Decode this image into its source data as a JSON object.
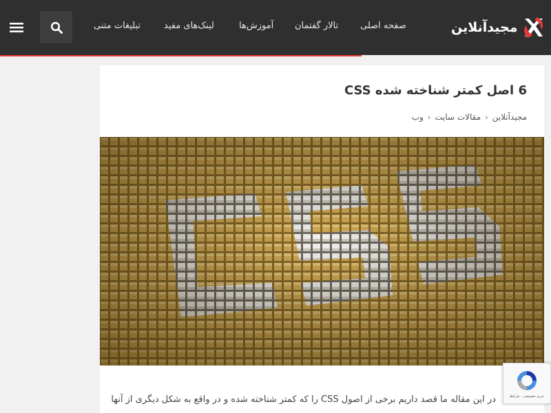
{
  "header": {
    "logo_text": "مجیدآنلاین",
    "nav": {
      "home": "صفحه اصلی",
      "forum": "تالار گفتمان",
      "tutorials": "آموزش‌ها",
      "useful_links": "لینک‌های مفید",
      "text_ads": "تبلیغات متنی"
    },
    "icons": {
      "menu": "hamburger-icon",
      "search": "search-icon",
      "logo": "x-logo-icon"
    }
  },
  "article": {
    "title": "6 اصل کمتر شناخته شده CSS",
    "breadcrumb": [
      "مجیدآنلاین",
      "مقالات سایت",
      "وب"
    ],
    "excerpt": "در این مقاله ما قصد داریم برخی از اصول CSS را که کمتر شناخته شده و در واقع به شکل دیگری از آنها"
  },
  "recaptcha": {
    "text": "حریم خصوصی - شرایط"
  },
  "colors": {
    "header_bg": "#2f2f2f",
    "accent": "#e53935",
    "tile": "#caa24a"
  }
}
